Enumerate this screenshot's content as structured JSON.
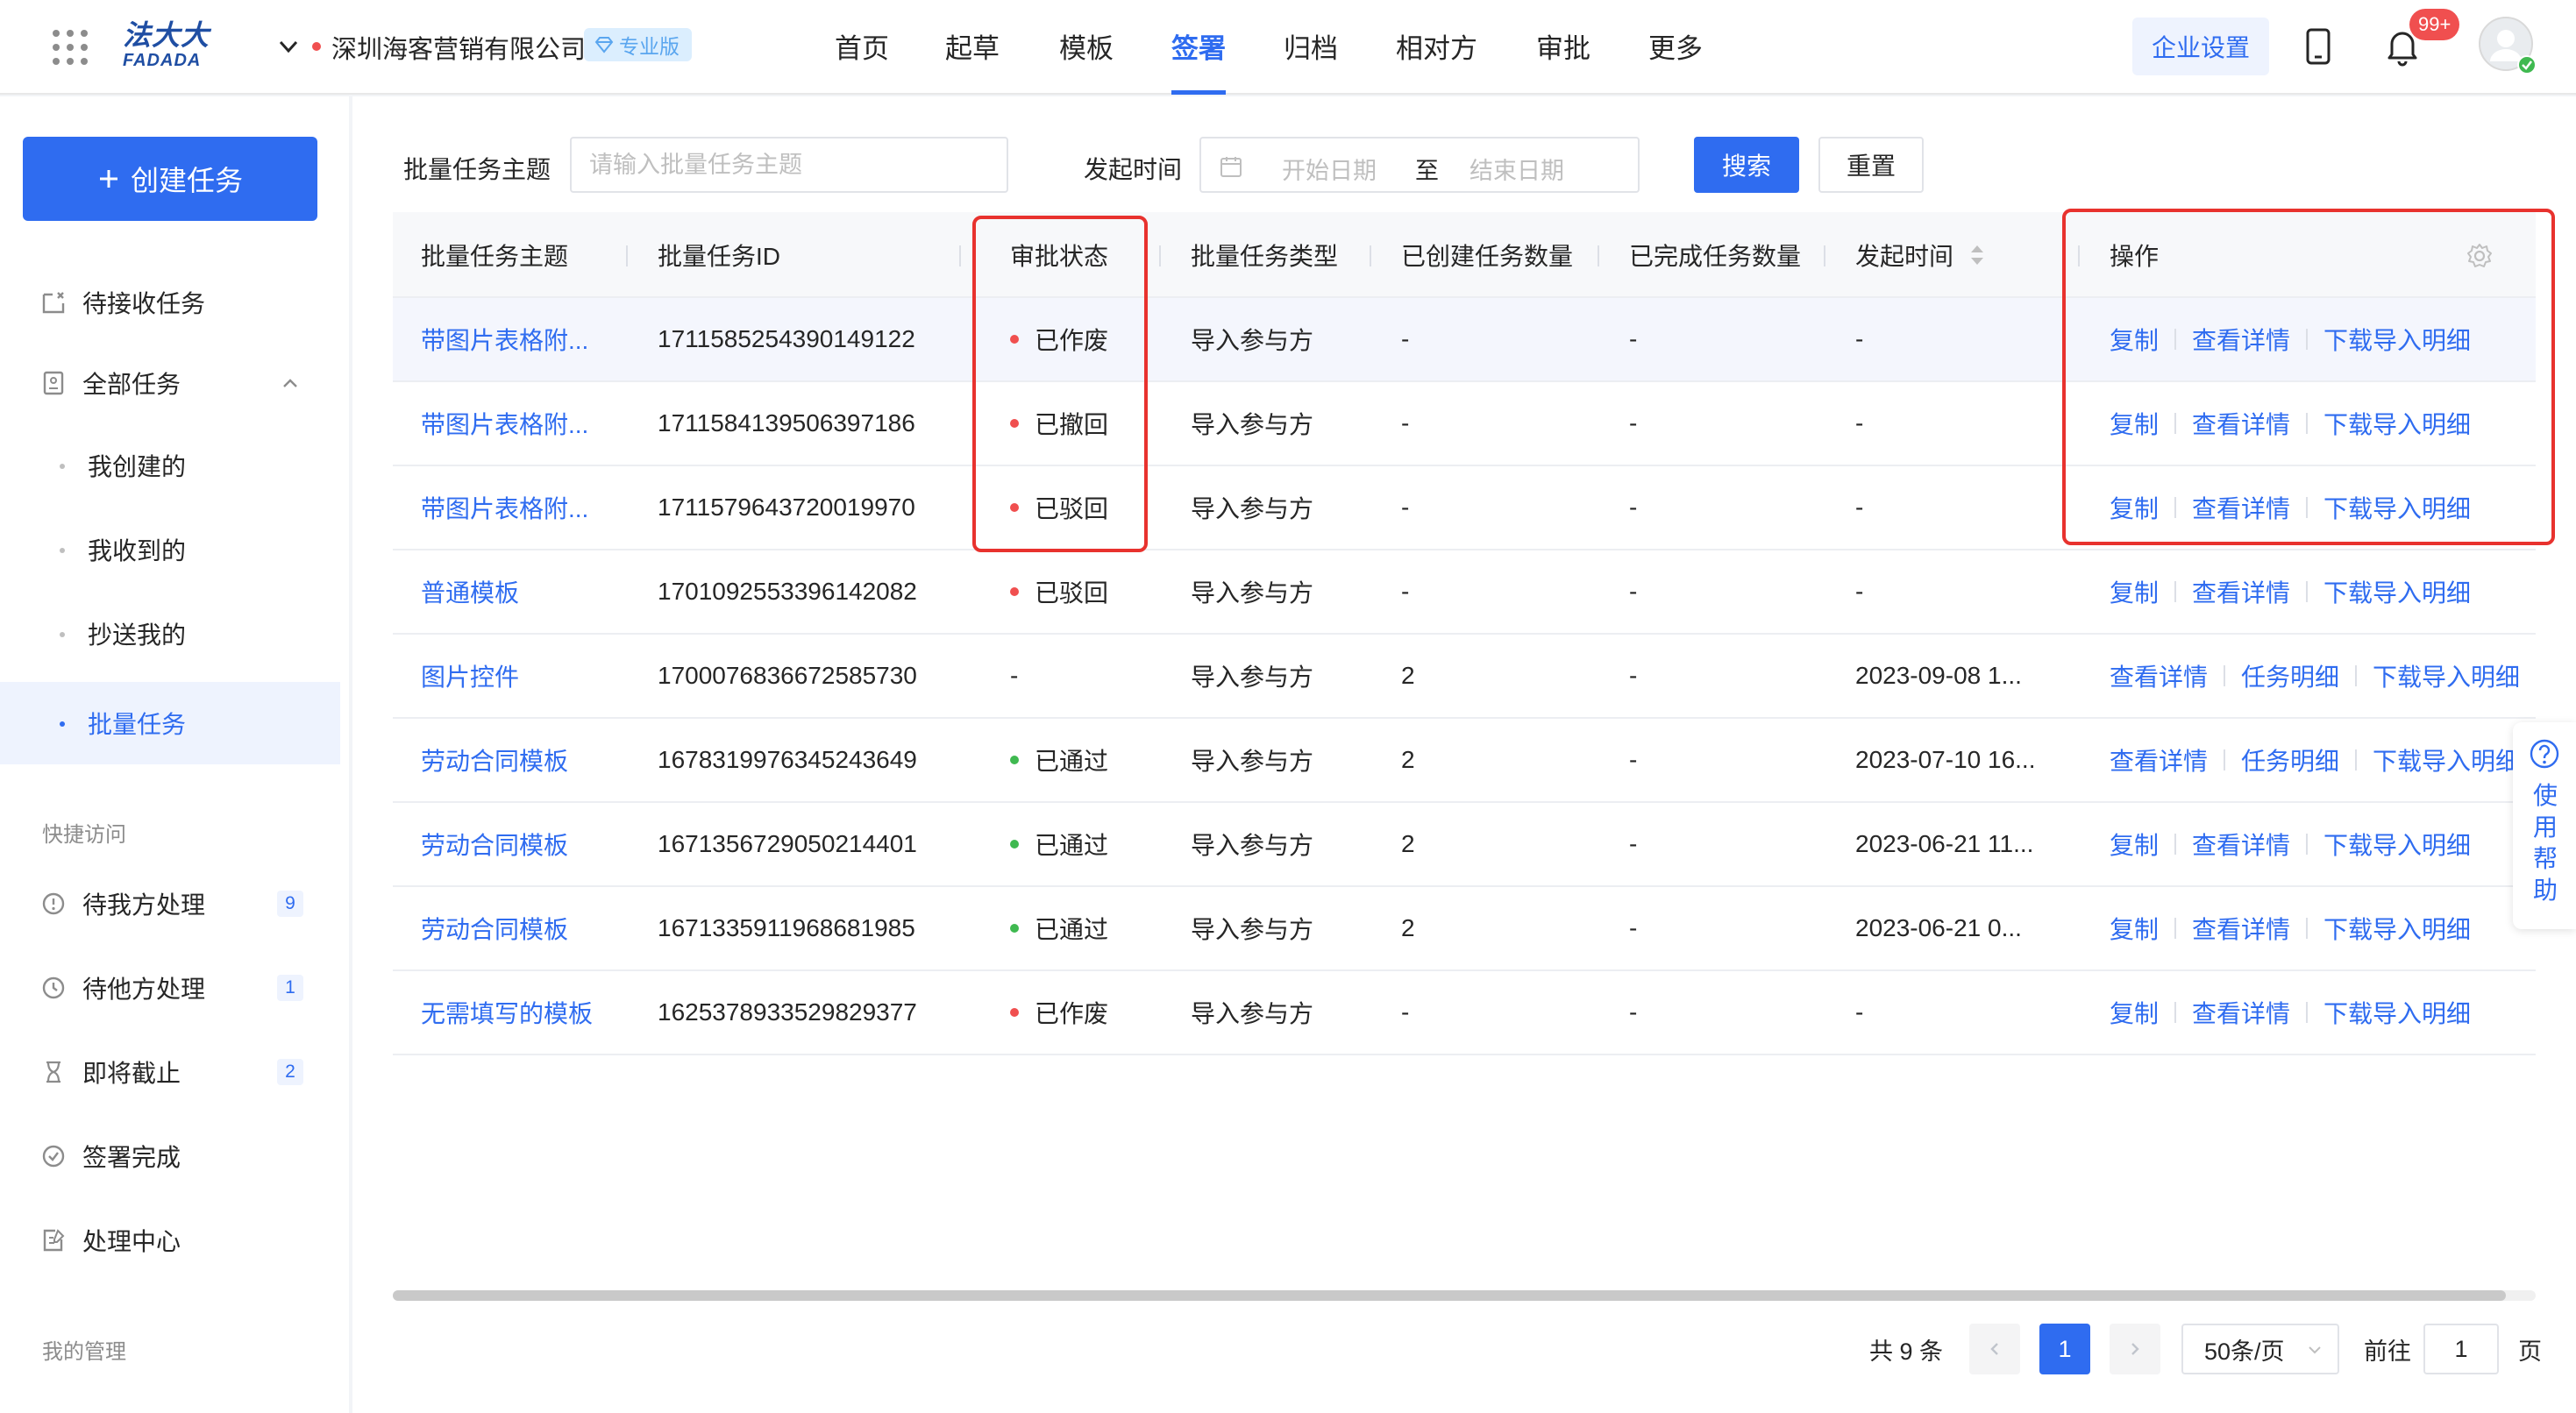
{
  "header": {
    "logo_cn": "法大大",
    "logo_en": "FADADA",
    "company_name": "深圳海客营销有限公司",
    "edition_badge": "专业版",
    "nav": [
      "首页",
      "起草",
      "模板",
      "签署",
      "归档",
      "相对方",
      "审批",
      "更多"
    ],
    "active_nav": "签署",
    "enterprise_settings": "企业设置",
    "notification_count": "99+"
  },
  "sidebar": {
    "create_task": "创建任务",
    "items": [
      {
        "label": "待接收任务",
        "icon": "inbox-icon"
      },
      {
        "label": "全部任务",
        "icon": "document-icon"
      },
      {
        "label": "我创建的"
      },
      {
        "label": "我收到的"
      },
      {
        "label": "抄送我的"
      },
      {
        "label": "批量任务"
      }
    ],
    "quick_access_title": "快捷访问",
    "quick_access": [
      {
        "label": "待我方处理",
        "count": "9",
        "icon": "alert-circle-icon"
      },
      {
        "label": "待他方处理",
        "count": "1",
        "icon": "clock-icon"
      },
      {
        "label": "即将截止",
        "count": "2",
        "icon": "hourglass-icon"
      },
      {
        "label": "签署完成",
        "icon": "check-circle-icon"
      },
      {
        "label": "处理中心",
        "icon": "edit-document-icon"
      }
    ],
    "management_title": "我的管理"
  },
  "filters": {
    "subject_label": "批量任务主题",
    "subject_placeholder": "请输入批量任务主题",
    "time_label": "发起时间",
    "start_placeholder": "开始日期",
    "range_separator": "至",
    "end_placeholder": "结束日期",
    "search": "搜索",
    "reset": "重置"
  },
  "table": {
    "columns": [
      "批量任务主题",
      "批量任务ID",
      "审批状态",
      "批量任务类型",
      "已创建任务数量",
      "已完成任务数量",
      "发起时间",
      "操作"
    ],
    "rows": [
      {
        "subject": "带图片表格附...",
        "id": "1711585254390149122",
        "status": "已作废",
        "status_color": "#f04f4f",
        "type": "导入参与方",
        "created": "-",
        "completed": "-",
        "time": "-",
        "ops": [
          "复制",
          "查看详情",
          "下载导入明细"
        ]
      },
      {
        "subject": "带图片表格附...",
        "id": "1711584139506397186",
        "status": "已撤回",
        "status_color": "#f04f4f",
        "type": "导入参与方",
        "created": "-",
        "completed": "-",
        "time": "-",
        "ops": [
          "复制",
          "查看详情",
          "下载导入明细"
        ]
      },
      {
        "subject": "带图片表格附...",
        "id": "1711579643720019970",
        "status": "已驳回",
        "status_color": "#f04f4f",
        "type": "导入参与方",
        "created": "-",
        "completed": "-",
        "time": "-",
        "ops": [
          "复制",
          "查看详情",
          "下载导入明细"
        ]
      },
      {
        "subject": "普通模板",
        "id": "1701092553396142082",
        "status": "已驳回",
        "status_color": "#f04f4f",
        "type": "导入参与方",
        "created": "-",
        "completed": "-",
        "time": "-",
        "ops": [
          "复制",
          "查看详情",
          "下载导入明细"
        ]
      },
      {
        "subject": "图片控件",
        "id": "1700076836672585730",
        "status": "-",
        "status_color": "",
        "type": "导入参与方",
        "created": "2",
        "completed": "-",
        "time": "2023-09-08 1...",
        "ops": [
          "查看详情",
          "任务明细",
          "下载导入明细"
        ]
      },
      {
        "subject": "劳动合同模板",
        "id": "1678319976345243649",
        "status": "已通过",
        "status_color": "#3fb950",
        "type": "导入参与方",
        "created": "2",
        "completed": "-",
        "time": "2023-07-10 16...",
        "ops": [
          "查看详情",
          "任务明细",
          "下载导入明细"
        ]
      },
      {
        "subject": "劳动合同模板",
        "id": "1671356729050214401",
        "status": "已通过",
        "status_color": "#3fb950",
        "type": "导入参与方",
        "created": "2",
        "completed": "-",
        "time": "2023-06-21 11...",
        "ops": [
          "复制",
          "查看详情",
          "下载导入明细"
        ]
      },
      {
        "subject": "劳动合同模板",
        "id": "1671335911968681985",
        "status": "已通过",
        "status_color": "#3fb950",
        "type": "导入参与方",
        "created": "2",
        "completed": "-",
        "time": "2023-06-21 0...",
        "ops": [
          "复制",
          "查看详情",
          "下载导入明细"
        ]
      },
      {
        "subject": "无需填写的模板",
        "id": "1625378933529829377",
        "status": "已作废",
        "status_color": "#f04f4f",
        "type": "导入参与方",
        "created": "-",
        "completed": "-",
        "time": "-",
        "ops": [
          "复制",
          "查看详情",
          "下载导入明细"
        ]
      }
    ]
  },
  "pagination": {
    "total": "共 9 条",
    "current_page": "1",
    "page_size": "50条/页",
    "goto_label": "前往",
    "goto_value": "1",
    "page_unit": "页"
  },
  "help": {
    "label": "使用帮助"
  },
  "colors": {
    "primary": "#2f6cf0",
    "danger": "#f04f4f",
    "success": "#3fb950",
    "highlight_border": "#e8322e"
  }
}
